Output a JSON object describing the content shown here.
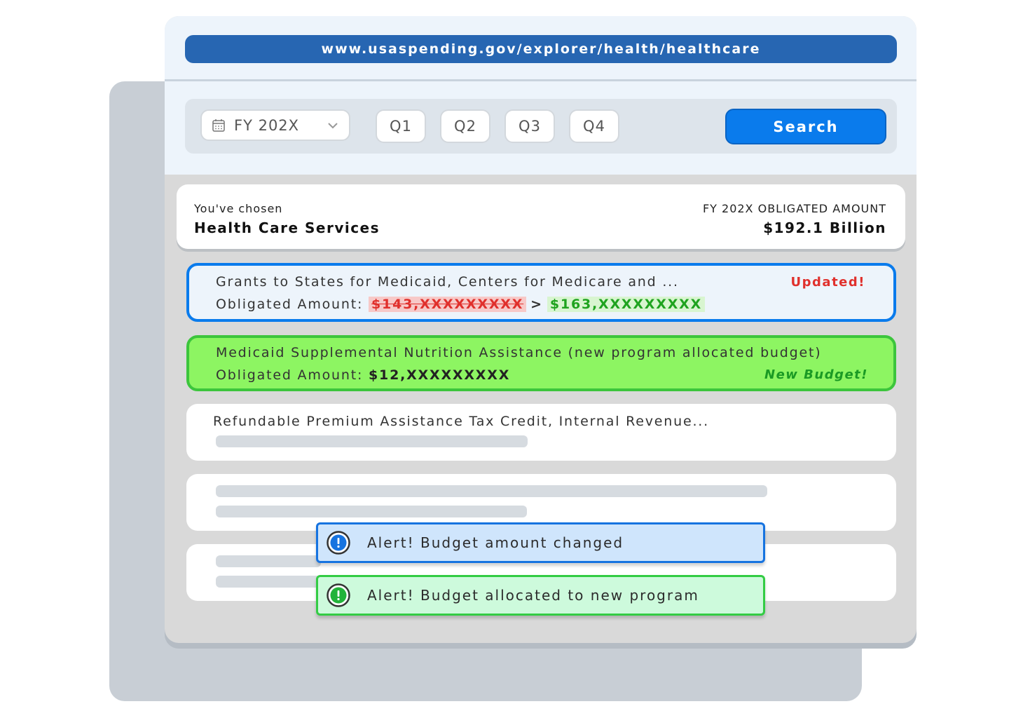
{
  "browser": {
    "url": "www.usaspending.gov/explorer/health/healthcare"
  },
  "filters": {
    "fiscal_year": "FY 202X",
    "quarters": [
      "Q1",
      "Q2",
      "Q3",
      "Q4"
    ],
    "search_label": "Search"
  },
  "summary": {
    "chosen_label": "You've chosen",
    "chosen_value": "Health Care Services",
    "amount_label": "FY 202X OBLIGATED AMOUNT",
    "amount_value": "$192.1 Billion"
  },
  "rows": [
    {
      "title": "Grants to States for Medicaid, Centers for Medicare and ...",
      "amount_label": "Obligated Amount:",
      "old_amount": "$143,XXXXXXXXX",
      "arrow": ">",
      "new_amount": "$163,XXXXXXXXX",
      "badge": "Updated!"
    },
    {
      "title": "Medicaid Supplemental Nutrition Assistance (new program allocated budget)",
      "amount_label": "Obligated Amount:",
      "amount": "$12,XXXXXXXXX",
      "badge": "New Budget!"
    },
    {
      "title": "Refundable Premium Assistance Tax Credit, Internal Revenue..."
    }
  ],
  "alerts": [
    {
      "text": "Alert! Budget amount changed",
      "icon": "info-icon",
      "color": "#1673e0"
    },
    {
      "text": "Alert! Budget allocated to new program",
      "icon": "info-icon",
      "color": "#22b33a"
    }
  ],
  "colors": {
    "primary_blue": "#0a7bec",
    "url_bar": "#2766b2",
    "updated_red": "#e0302c",
    "new_green": "#8df562"
  }
}
